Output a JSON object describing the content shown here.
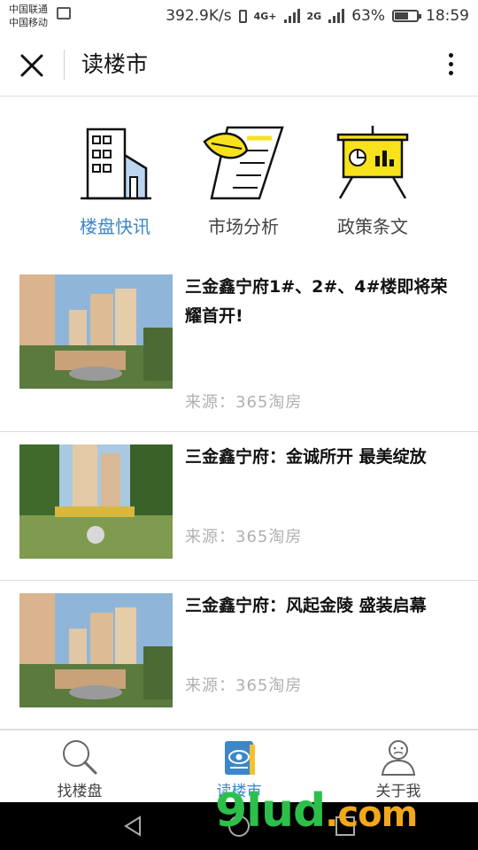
{
  "status_bar": {
    "carrier1": "中国联通",
    "carrier2": "中国移动",
    "speed": "392.9K/s",
    "network1": "4G+",
    "network2": "2G",
    "battery": "63%",
    "battery_level": 0.63,
    "time": "18:59"
  },
  "header": {
    "title": "读楼市"
  },
  "categories": [
    {
      "label": "楼盘快讯",
      "icon": "building-icon",
      "active": true
    },
    {
      "label": "市场分析",
      "icon": "document-feather-icon",
      "active": false
    },
    {
      "label": "政策条文",
      "icon": "presentation-board-icon",
      "active": false
    }
  ],
  "articles": [
    {
      "title": "三金鑫宁府1#、2#、4#楼即将荣耀首开!",
      "source": "来源：365淘房"
    },
    {
      "title": "三金鑫宁府：金诚所开 最美绽放",
      "source": "来源：365淘房"
    },
    {
      "title": "三金鑫宁府：风起金陵 盛装启幕",
      "source": "来源：365淘房"
    }
  ],
  "tabbar": [
    {
      "label": "找楼盘",
      "icon": "magnifier-icon",
      "active": false
    },
    {
      "label": "读楼市",
      "icon": "book-eye-icon",
      "active": true
    },
    {
      "label": "关于我",
      "icon": "person-icon",
      "active": false
    }
  ],
  "watermark": {
    "text": "9lud",
    "suffix": ".com"
  },
  "colors": {
    "accent": "#3d87c9",
    "icon_yellow": "#f8e21c",
    "divider": "#dcdcdc"
  }
}
